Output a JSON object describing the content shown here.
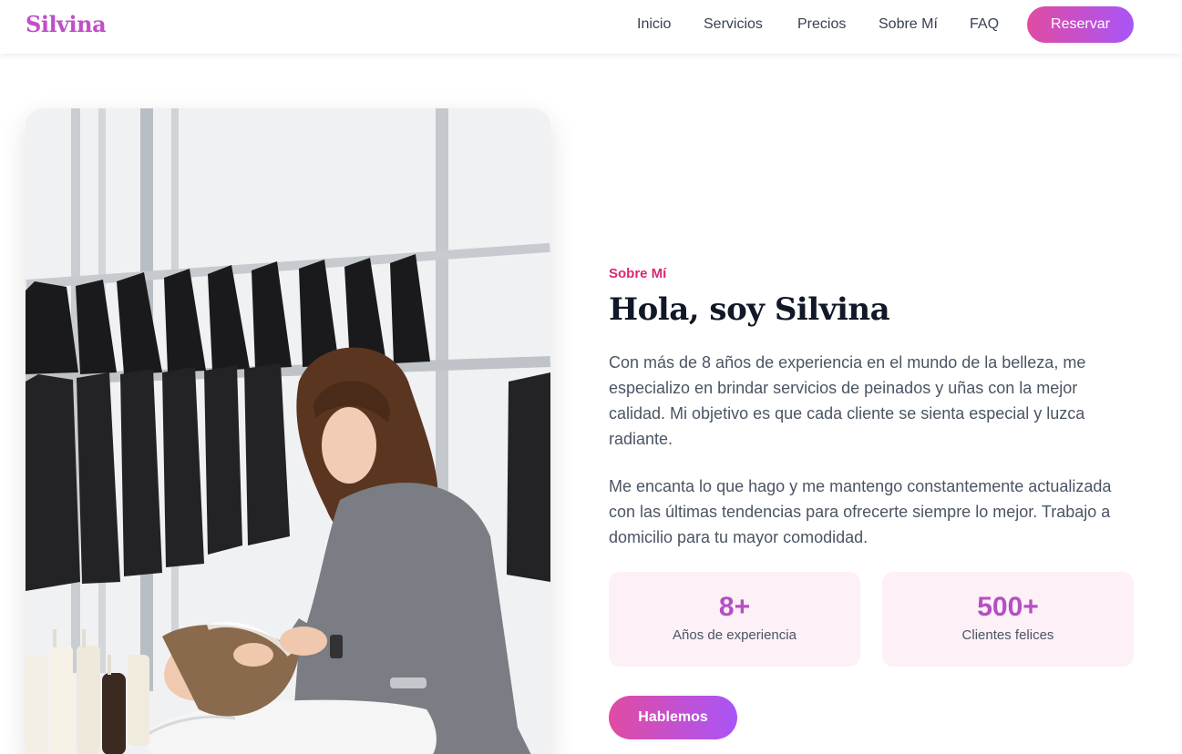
{
  "brand": {
    "name": "Silvina"
  },
  "nav": {
    "items": [
      {
        "label": "Inicio"
      },
      {
        "label": "Servicios"
      },
      {
        "label": "Precios"
      },
      {
        "label": "Sobre Mí"
      },
      {
        "label": "FAQ"
      }
    ],
    "cta_label": "Reservar"
  },
  "about": {
    "eyebrow": "Sobre Mí",
    "title": "Hola, soy Silvina",
    "paragraphs": [
      "Con más de 8 años de experiencia en el mundo de la belleza, me especializo en brindar servicios de peinados y uñas con la mejor calidad. Mi objetivo es que cada cliente se sienta especial y luzca radiante.",
      "Me encanta lo que hago y me mantengo constantemente actualizada con las últimas tendencias para ofrecerte siempre lo mejor. Trabajo a domicilio para tu mayor comodidad."
    ],
    "stats": [
      {
        "value": "8+",
        "label": "Años de experiencia"
      },
      {
        "value": "500+",
        "label": "Clientes felices"
      }
    ],
    "cta_label": "Hablemos",
    "photo_icon": "salon-photo"
  },
  "colors": {
    "brand": "#c04fc9",
    "accent_pink": "#db2777",
    "gradient_start": "#e14ba2",
    "gradient_end": "#a855f7",
    "stat_bg": "#fdf0f6"
  }
}
